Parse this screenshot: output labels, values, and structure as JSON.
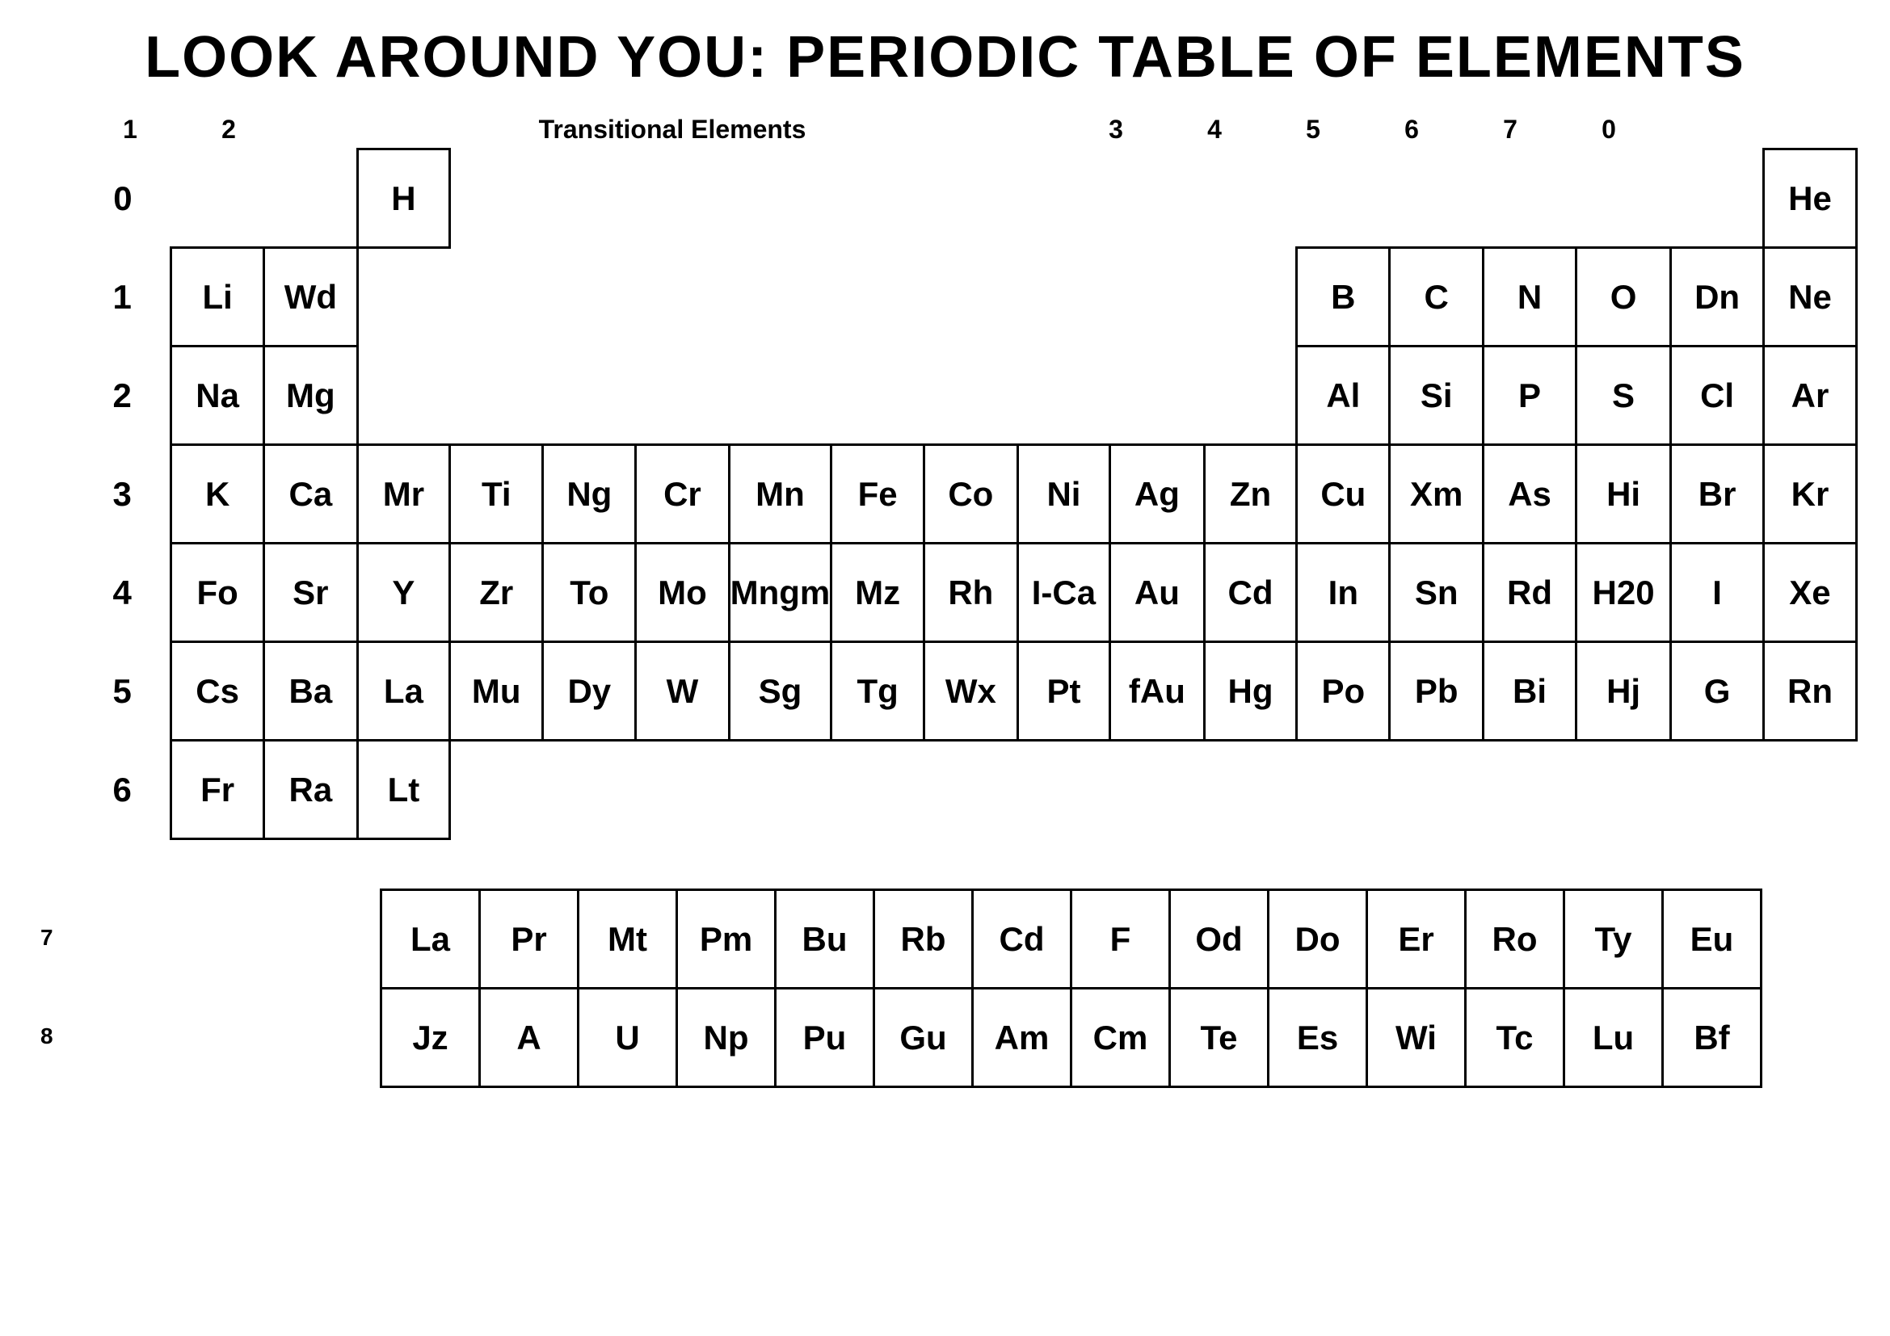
{
  "title": "LOOK AROUND YOU: PERIODIC TABLE OF ELEMENTS",
  "column_headers": {
    "col1": "1",
    "col2": "2",
    "transitional": "Transitional Elements",
    "col3": "3",
    "col4": "4",
    "col5": "5",
    "col6": "6",
    "col7": "7",
    "col0": "0"
  },
  "rows": [
    {
      "label": "0",
      "cells": [
        {
          "symbol": "",
          "empty": true
        },
        {
          "symbol": "",
          "empty": true
        },
        {
          "symbol": "H",
          "empty": false
        },
        {
          "symbol": "",
          "empty": true
        },
        {
          "symbol": "",
          "empty": true
        },
        {
          "symbol": "",
          "empty": true
        },
        {
          "symbol": "",
          "empty": true
        },
        {
          "symbol": "",
          "empty": true
        },
        {
          "symbol": "",
          "empty": true
        },
        {
          "symbol": "",
          "empty": true
        },
        {
          "symbol": "",
          "empty": true
        },
        {
          "symbol": "",
          "empty": true
        },
        {
          "symbol": "",
          "empty": true
        },
        {
          "symbol": "",
          "empty": true
        },
        {
          "symbol": "",
          "empty": true
        },
        {
          "symbol": "",
          "empty": true
        },
        {
          "symbol": "",
          "empty": true
        },
        {
          "symbol": "He",
          "empty": false
        }
      ]
    },
    {
      "label": "1",
      "cells": [
        {
          "symbol": "Li",
          "empty": false
        },
        {
          "symbol": "Wd",
          "empty": false
        },
        {
          "symbol": "",
          "empty": true
        },
        {
          "symbol": "",
          "empty": true
        },
        {
          "symbol": "",
          "empty": true
        },
        {
          "symbol": "",
          "empty": true
        },
        {
          "symbol": "",
          "empty": true
        },
        {
          "symbol": "",
          "empty": true
        },
        {
          "symbol": "",
          "empty": true
        },
        {
          "symbol": "",
          "empty": true
        },
        {
          "symbol": "",
          "empty": true
        },
        {
          "symbol": "",
          "empty": true
        },
        {
          "symbol": "B",
          "empty": false
        },
        {
          "symbol": "C",
          "empty": false
        },
        {
          "symbol": "N",
          "empty": false
        },
        {
          "symbol": "O",
          "empty": false
        },
        {
          "symbol": "Dn",
          "empty": false
        },
        {
          "symbol": "Ne",
          "empty": false
        }
      ]
    },
    {
      "label": "2",
      "cells": [
        {
          "symbol": "Na",
          "empty": false
        },
        {
          "symbol": "Mg",
          "empty": false
        },
        {
          "symbol": "",
          "empty": true
        },
        {
          "symbol": "",
          "empty": true
        },
        {
          "symbol": "",
          "empty": true
        },
        {
          "symbol": "",
          "empty": true
        },
        {
          "symbol": "",
          "empty": true
        },
        {
          "symbol": "",
          "empty": true
        },
        {
          "symbol": "",
          "empty": true
        },
        {
          "symbol": "",
          "empty": true
        },
        {
          "symbol": "",
          "empty": true
        },
        {
          "symbol": "",
          "empty": true
        },
        {
          "symbol": "Al",
          "empty": false
        },
        {
          "symbol": "Si",
          "empty": false
        },
        {
          "symbol": "P",
          "empty": false
        },
        {
          "symbol": "S",
          "empty": false
        },
        {
          "symbol": "Cl",
          "empty": false
        },
        {
          "symbol": "Ar",
          "empty": false
        }
      ]
    },
    {
      "label": "3",
      "cells": [
        {
          "symbol": "K",
          "empty": false
        },
        {
          "symbol": "Ca",
          "empty": false
        },
        {
          "symbol": "Mr",
          "empty": false
        },
        {
          "symbol": "Ti",
          "empty": false
        },
        {
          "symbol": "Ng",
          "empty": false
        },
        {
          "symbol": "Cr",
          "empty": false
        },
        {
          "symbol": "Mn",
          "empty": false
        },
        {
          "symbol": "Fe",
          "empty": false
        },
        {
          "symbol": "Co",
          "empty": false
        },
        {
          "symbol": "Ni",
          "empty": false
        },
        {
          "symbol": "Ag",
          "empty": false
        },
        {
          "symbol": "Zn",
          "empty": false
        },
        {
          "symbol": "Cu",
          "empty": false
        },
        {
          "symbol": "Xm",
          "empty": false
        },
        {
          "symbol": "As",
          "empty": false
        },
        {
          "symbol": "Hi",
          "empty": false
        },
        {
          "symbol": "Br",
          "empty": false
        },
        {
          "symbol": "Kr",
          "empty": false
        }
      ]
    },
    {
      "label": "4",
      "cells": [
        {
          "symbol": "Fo",
          "empty": false
        },
        {
          "symbol": "Sr",
          "empty": false
        },
        {
          "symbol": "Y",
          "empty": false
        },
        {
          "symbol": "Zr",
          "empty": false
        },
        {
          "symbol": "To",
          "empty": false
        },
        {
          "symbol": "Mo",
          "empty": false
        },
        {
          "symbol": "Mngm",
          "empty": false
        },
        {
          "symbol": "Mz",
          "empty": false
        },
        {
          "symbol": "Rh",
          "empty": false
        },
        {
          "symbol": "I-Ca",
          "empty": false
        },
        {
          "symbol": "Au",
          "empty": false
        },
        {
          "symbol": "Cd",
          "empty": false
        },
        {
          "symbol": "In",
          "empty": false
        },
        {
          "symbol": "Sn",
          "empty": false
        },
        {
          "symbol": "Rd",
          "empty": false
        },
        {
          "symbol": "H20",
          "empty": false
        },
        {
          "symbol": "I",
          "empty": false
        },
        {
          "symbol": "Xe",
          "empty": false
        }
      ]
    },
    {
      "label": "5",
      "cells": [
        {
          "symbol": "Cs",
          "empty": false
        },
        {
          "symbol": "Ba",
          "empty": false
        },
        {
          "symbol": "La",
          "empty": false
        },
        {
          "symbol": "Mu",
          "empty": false
        },
        {
          "symbol": "Dy",
          "empty": false
        },
        {
          "symbol": "W",
          "empty": false
        },
        {
          "symbol": "Sg",
          "empty": false
        },
        {
          "symbol": "Tg",
          "empty": false
        },
        {
          "symbol": "Wx",
          "empty": false
        },
        {
          "symbol": "Pt",
          "empty": false
        },
        {
          "symbol": "fAu",
          "empty": false
        },
        {
          "symbol": "Hg",
          "empty": false
        },
        {
          "symbol": "Po",
          "empty": false
        },
        {
          "symbol": "Pb",
          "empty": false
        },
        {
          "symbol": "Bi",
          "empty": false
        },
        {
          "symbol": "Hj",
          "empty": false
        },
        {
          "symbol": "G",
          "empty": false
        },
        {
          "symbol": "Rn",
          "empty": false
        }
      ]
    },
    {
      "label": "6",
      "cells": [
        {
          "symbol": "Fr",
          "empty": false
        },
        {
          "symbol": "Ra",
          "empty": false
        },
        {
          "symbol": "Lt",
          "empty": false
        },
        {
          "symbol": "",
          "empty": true
        },
        {
          "symbol": "",
          "empty": true
        },
        {
          "symbol": "",
          "empty": true
        },
        {
          "symbol": "",
          "empty": true
        },
        {
          "symbol": "",
          "empty": true
        },
        {
          "symbol": "",
          "empty": true
        },
        {
          "symbol": "",
          "empty": true
        },
        {
          "symbol": "",
          "empty": true
        },
        {
          "symbol": "",
          "empty": true
        },
        {
          "symbol": "",
          "empty": true
        },
        {
          "symbol": "",
          "empty": true
        },
        {
          "symbol": "",
          "empty": true
        },
        {
          "symbol": "",
          "empty": true
        },
        {
          "symbol": "",
          "empty": true
        },
        {
          "symbol": "",
          "empty": true
        }
      ]
    }
  ],
  "bottom_rows": [
    {
      "label": "7",
      "cells": [
        "La",
        "Pr",
        "Mt",
        "Pm",
        "Bu",
        "Rb",
        "Cd",
        "F",
        "Od",
        "Do",
        "Er",
        "Ro",
        "Ty",
        "Eu"
      ]
    },
    {
      "label": "8",
      "cells": [
        "Jz",
        "A",
        "U",
        "Np",
        "Pu",
        "Gu",
        "Am",
        "Cm",
        "Te",
        "Es",
        "Wi",
        "Tc",
        "Lu",
        "Bf"
      ]
    }
  ]
}
